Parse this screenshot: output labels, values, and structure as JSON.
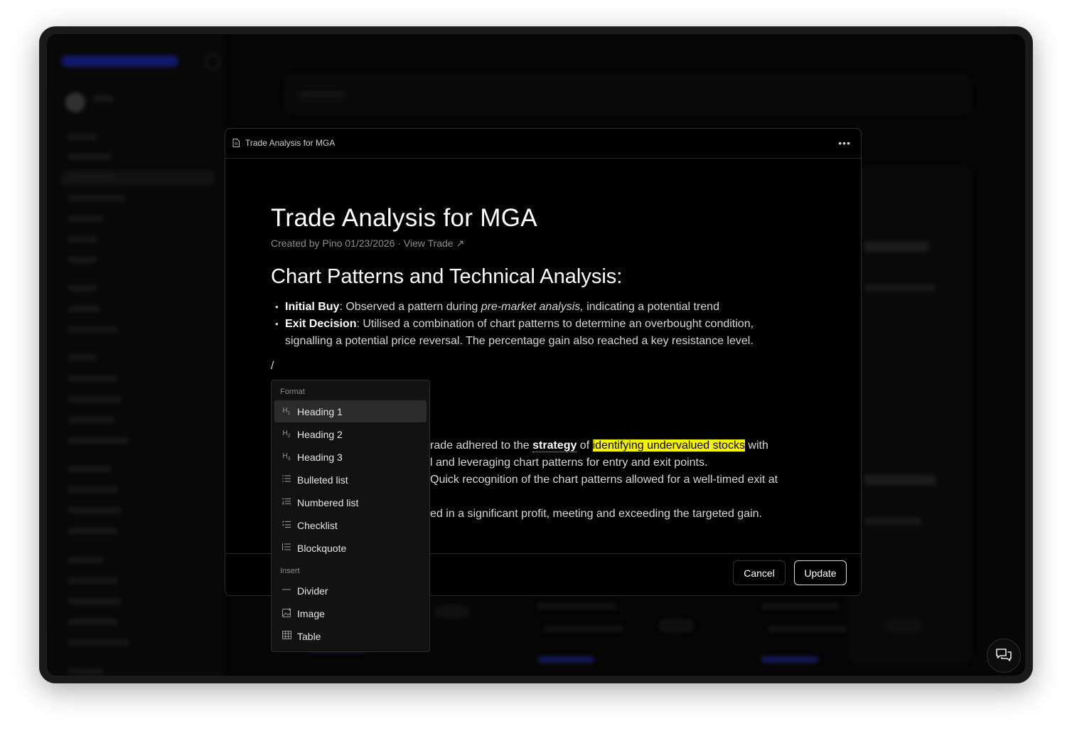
{
  "modal": {
    "header_title": "Trade Analysis for MGA",
    "more_label": "•••"
  },
  "document": {
    "title": "Trade Analysis for MGA",
    "meta_prefix": "Created by Pino 01/23/2026 · ",
    "meta_link": "View Trade ↗",
    "section_heading": "Chart Patterns and Technical Analysis:",
    "bullets": [
      {
        "bold": "Initial Buy",
        "text1": ": Observed a pattern during ",
        "italic": "pre-market analysis,",
        "text2": " indicating a potential trend"
      },
      {
        "bold": "Exit Decision",
        "text1": ": Utilised a combination of chart patterns to determine an overbought condition,",
        "text2": "signalling a potential price reversal. The percentage gain also reached a key resistance level."
      }
    ],
    "slash": "/",
    "para_line1_a": "rade adhered to the ",
    "para_line1_strategy": "strategy",
    "para_line1_of": " of ",
    "para_line1_highlight": "identifying undervalued stocks",
    "para_line1_end": " with",
    "para_line2": "l and leveraging chart patterns for entry and exit points.",
    "para_line3": "Quick recognition of the chart patterns allowed for a well-timed exit at",
    "para_line4": "ed in a significant profit, meeting and exceeding the targeted gain."
  },
  "footer": {
    "cancel_label": "Cancel",
    "update_label": "Update"
  },
  "menu": {
    "format_label": "Format",
    "insert_label": "Insert",
    "format_items": [
      {
        "icon": "H1",
        "label": "Heading 1"
      },
      {
        "icon": "H2",
        "label": "Heading 2"
      },
      {
        "icon": "H3",
        "label": "Heading 3"
      },
      {
        "icon": "bulleted-list-icon",
        "label": "Bulleted list"
      },
      {
        "icon": "numbered-list-icon",
        "label": "Numbered list"
      },
      {
        "icon": "checklist-icon",
        "label": "Checklist"
      },
      {
        "icon": "blockquote-icon",
        "label": "Blockquote"
      }
    ],
    "insert_items": [
      {
        "icon": "divider-icon",
        "label": "Divider"
      },
      {
        "icon": "image-icon",
        "label": "Image"
      },
      {
        "icon": "table-icon",
        "label": "Table"
      }
    ],
    "active_item": "Heading 1"
  },
  "colors": {
    "highlight": "#f5f200",
    "modal_bg": "#000000",
    "menu_bg": "#121212",
    "brand_blue": "#1b2bbd"
  }
}
